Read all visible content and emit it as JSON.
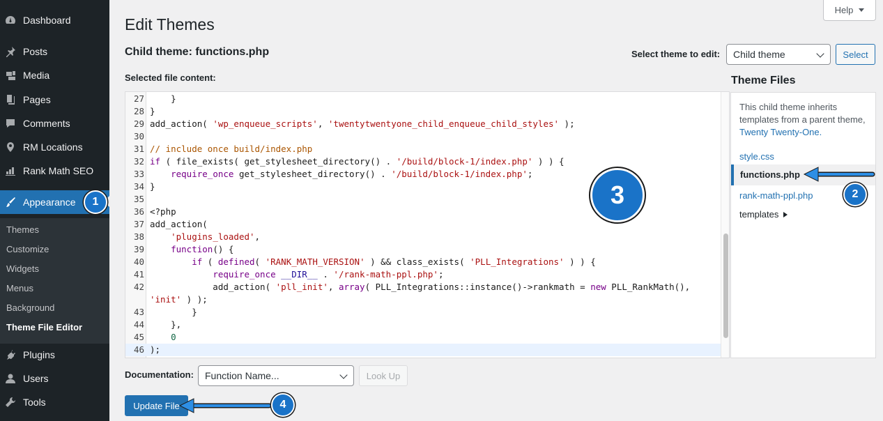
{
  "sidebar": {
    "items": [
      {
        "label": "Dashboard",
        "icon": "dashboard-icon"
      },
      {
        "label": "Posts",
        "icon": "pin-icon"
      },
      {
        "label": "Media",
        "icon": "media-icon"
      },
      {
        "label": "Pages",
        "icon": "pages-icon"
      },
      {
        "label": "Comments",
        "icon": "comment-icon"
      },
      {
        "label": "RM Locations",
        "icon": "location-icon"
      },
      {
        "label": "Rank Math SEO",
        "icon": "chart-icon"
      },
      {
        "label": "Appearance",
        "icon": "brush-icon"
      },
      {
        "label": "Plugins",
        "icon": "plugin-icon"
      },
      {
        "label": "Users",
        "icon": "user-icon"
      },
      {
        "label": "Tools",
        "icon": "wrench-icon"
      }
    ],
    "submenu": [
      "Themes",
      "Customize",
      "Widgets",
      "Menus",
      "Background",
      "Theme File Editor"
    ]
  },
  "header": {
    "title": "Edit Themes",
    "help_label": "Help"
  },
  "editor": {
    "file_heading": "Child theme: functions.php",
    "select_theme_label": "Select theme to edit:",
    "selected_theme": "Child theme",
    "select_button": "Select",
    "content_label": "Selected file content:"
  },
  "theme_files": {
    "title": "Theme Files",
    "inherit_text": "This child theme inherits templates from a parent theme,",
    "parent_theme_link": "Twenty Twenty-One.",
    "files": [
      "style.css",
      "functions.php",
      "rank-math-ppl.php"
    ],
    "templates_label": "templates"
  },
  "documentation": {
    "label": "Documentation:",
    "select_value": "Function Name...",
    "lookup_button": "Look Up"
  },
  "update_button": "Update File",
  "callouts": [
    "1",
    "2",
    "3",
    "4"
  ],
  "colors": {
    "sidebar_bg": "#1d2327",
    "accent": "#2271b1",
    "callout": "#1a73c8"
  }
}
